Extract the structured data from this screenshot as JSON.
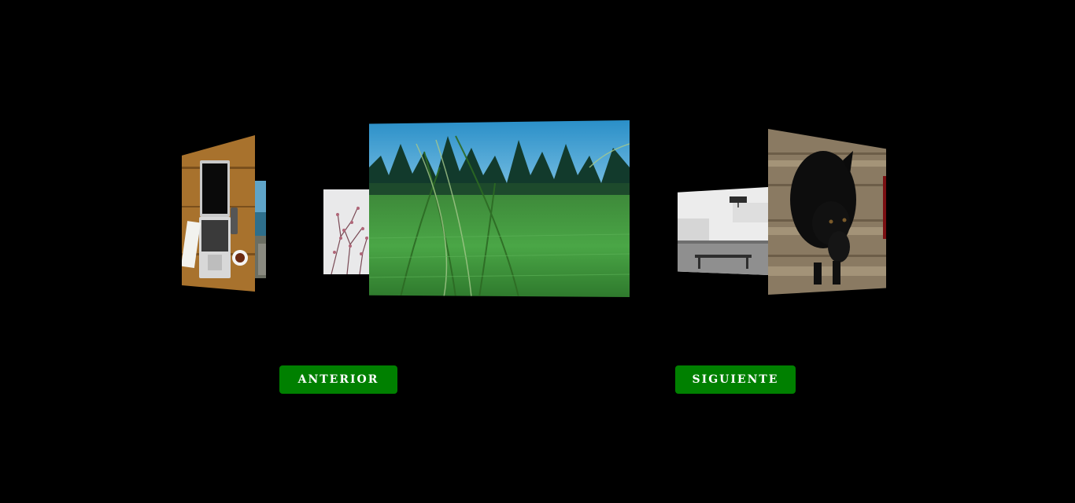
{
  "carousel": {
    "slides": [
      {
        "icon": "laptop-desk-photo"
      },
      {
        "icon": "sea-rocks-photo"
      },
      {
        "icon": "pink-branches-photo"
      },
      {
        "icon": "grass-field-photo"
      },
      {
        "icon": "white-wall-bench-photo"
      },
      {
        "icon": "black-dog-photo"
      }
    ]
  },
  "controls": {
    "prev_label": "ANTERIOR",
    "next_label": "SIGUIENTE",
    "button_color": "#008000"
  }
}
